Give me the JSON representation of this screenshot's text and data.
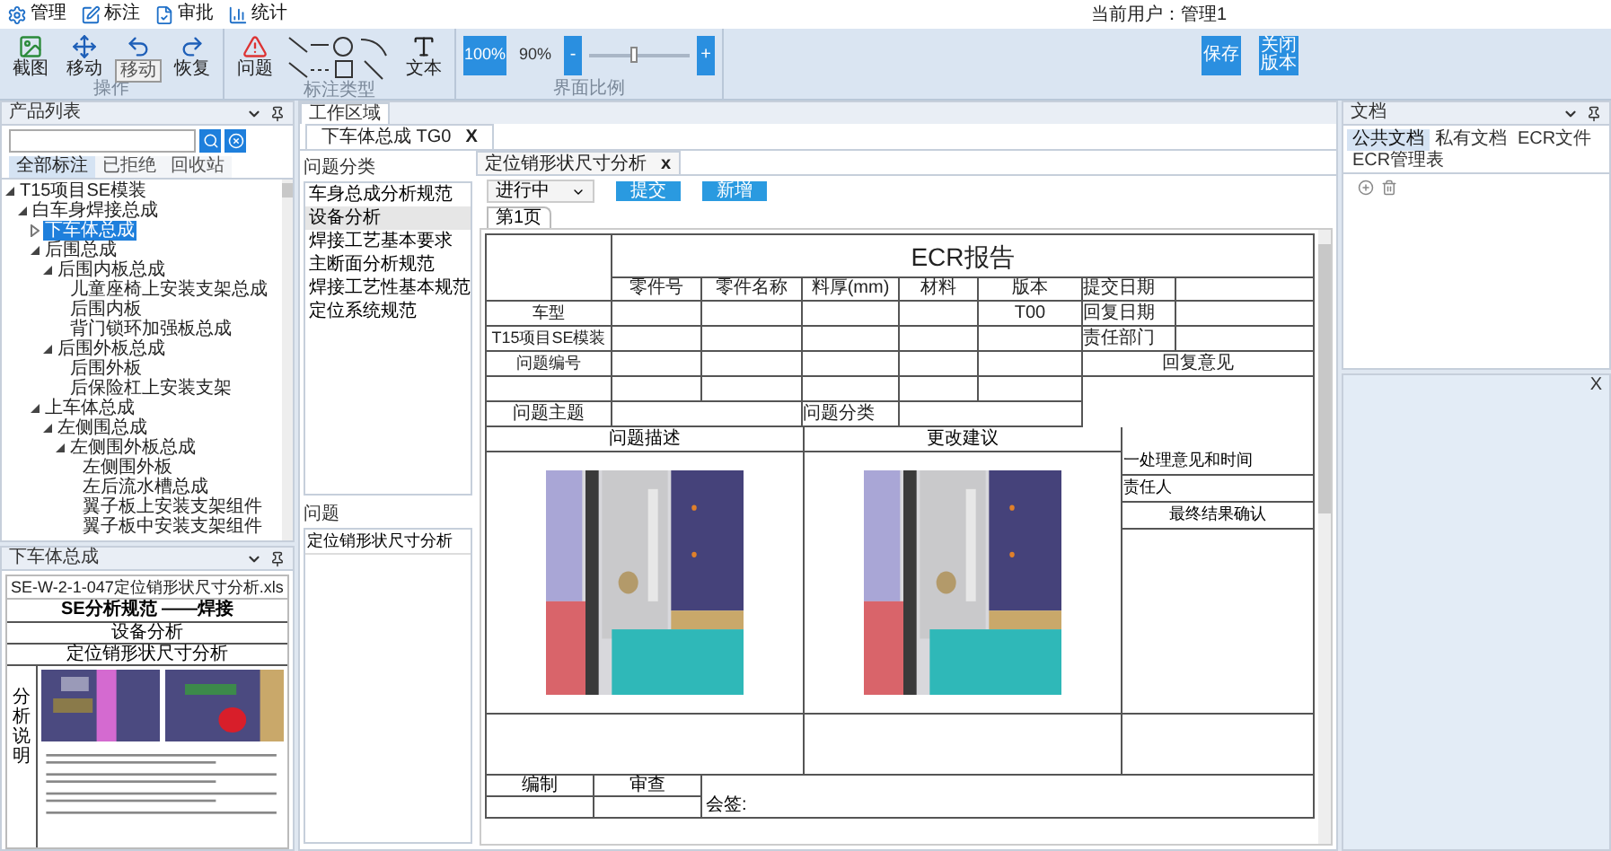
{
  "menu": [
    {
      "label": "管理"
    },
    {
      "label": "标注"
    },
    {
      "label": "审批"
    },
    {
      "label": "统计"
    }
  ],
  "current_user": "当前用户：管理1",
  "ribbon": {
    "groups": [
      {
        "title": "操作",
        "tools": [
          {
            "kind": "button",
            "label": "截图"
          },
          {
            "kind": "button",
            "label": "移动"
          },
          {
            "kind": "button",
            "tooltip": "移动"
          },
          {
            "kind": "button",
            "label": "恢复"
          }
        ]
      },
      {
        "title": "标注类型",
        "tools": [
          {
            "kind": "button",
            "label": "问题"
          },
          {
            "kind": "shapes"
          },
          {
            "kind": "button",
            "label": "文本"
          }
        ]
      }
    ],
    "zoom": {
      "title": "界面比例",
      "presets": [
        {
          "label": "100%",
          "selected": true
        },
        {
          "label": "90%",
          "selected": false
        }
      ],
      "minus": "-",
      "plus": "+",
      "level": 0.45
    },
    "actions": [
      {
        "label": "保存"
      },
      {
        "label": "关闭版本"
      }
    ]
  },
  "product_panel": {
    "title": "产品列表",
    "tabs": [
      {
        "label": "全部标注",
        "selected": true
      },
      {
        "label": "已拒绝",
        "selected": false
      },
      {
        "label": "回收站",
        "selected": false
      }
    ],
    "tree": [
      {
        "label": "T15项目SE模装",
        "expanded": true,
        "selected": false,
        "children": [
          {
            "label": "白车身焊接总成",
            "expanded": true,
            "selected": false,
            "children": [
              {
                "label": "下车体总成",
                "expanded": false,
                "selected": true
              },
              {
                "label": "后围总成",
                "expanded": true,
                "selected": false,
                "children": [
                  {
                    "label": "后围内板总成",
                    "expanded": true,
                    "selected": false,
                    "children": [
                      {
                        "label": "儿童座椅上安装支架总成",
                        "selected": false
                      },
                      {
                        "label": "后围内板",
                        "selected": false
                      },
                      {
                        "label": "背门锁环加强板总成",
                        "selected": false
                      }
                    ]
                  },
                  {
                    "label": "后围外板总成",
                    "expanded": true,
                    "selected": false,
                    "children": [
                      {
                        "label": "后围外板",
                        "selected": false
                      },
                      {
                        "label": "后保险杠上安装支架",
                        "selected": false
                      }
                    ]
                  }
                ]
              },
              {
                "label": "上车体总成",
                "expanded": true,
                "selected": false,
                "children": [
                  {
                    "label": "左侧围总成",
                    "expanded": true,
                    "selected": false,
                    "children": [
                      {
                        "label": "左侧围外板总成",
                        "expanded": true,
                        "selected": false,
                        "children": [
                          {
                            "label": "左侧围外板",
                            "selected": false
                          },
                          {
                            "label": "左后流水槽总成",
                            "selected": false
                          },
                          {
                            "label": "翼子板上安装支架组件",
                            "selected": false
                          },
                          {
                            "label": "翼子板中安装支架组件",
                            "selected": false
                          }
                        ]
                      }
                    ]
                  }
                ]
              }
            ]
          }
        ]
      }
    ]
  },
  "file_panel": {
    "title": "下车体总成",
    "tab": "SE-W-2-1-047定位销形状尺寸分析.xls",
    "doc": {
      "title": "SE分析规范 ——焊接",
      "subtitle": "设备分析",
      "item": "定位销形状尺寸分析",
      "side": "分析说明"
    }
  },
  "work_area": {
    "title": "工作区域",
    "tab": {
      "label": "下车体总成 TG0",
      "close": "X"
    },
    "category_title": "问题分类",
    "categories": [
      {
        "label": "车身总成分析规范",
        "selected": false
      },
      {
        "label": "设备分析",
        "selected": true
      },
      {
        "label": "焊接工艺基本要求",
        "selected": false
      },
      {
        "label": "主断面分析规范",
        "selected": false
      },
      {
        "label": "焊接工艺性基本规范",
        "selected": false
      },
      {
        "label": "定位系统规范",
        "selected": false
      }
    ],
    "issue_title": "问题",
    "issues": [
      {
        "label": "定位销形状尺寸分析",
        "selected": false
      }
    ],
    "doc_tab": {
      "label": "定位销形状尺寸分析",
      "close": "x"
    },
    "status": "进行中",
    "buttons": [
      {
        "label": "提交"
      },
      {
        "label": "新增"
      }
    ],
    "page_tab": "第1页",
    "ecr": {
      "title": "ECR报告",
      "columns": [
        "零件号",
        "零件名称",
        "料厚(mm)",
        "材料",
        "版本"
      ],
      "row_labels": [
        "车型",
        "T15项目SE模装",
        "问题编号"
      ],
      "version_value": "T00",
      "side_labels": [
        "提交日期",
        "回复日期",
        "责任部门"
      ],
      "reply_label": "回复意见",
      "topic_label": "问题主题",
      "category_label": "问题分类",
      "description_label": "问题描述",
      "suggestion_label": "更改建议",
      "right_labels": [
        "一处理意见和时间",
        "责任人",
        "最终结果确认"
      ],
      "footer_labels": [
        "编制",
        "审查"
      ],
      "countersign": "会签:"
    }
  },
  "docs_panel": {
    "title": "文档",
    "tabs": [
      {
        "label": "公共文档",
        "selected": true
      },
      {
        "label": "私有文档",
        "selected": false
      },
      {
        "label": "ECR文件",
        "selected": false
      },
      {
        "label": "ECR管理表",
        "selected": false
      }
    ],
    "close": "X"
  }
}
